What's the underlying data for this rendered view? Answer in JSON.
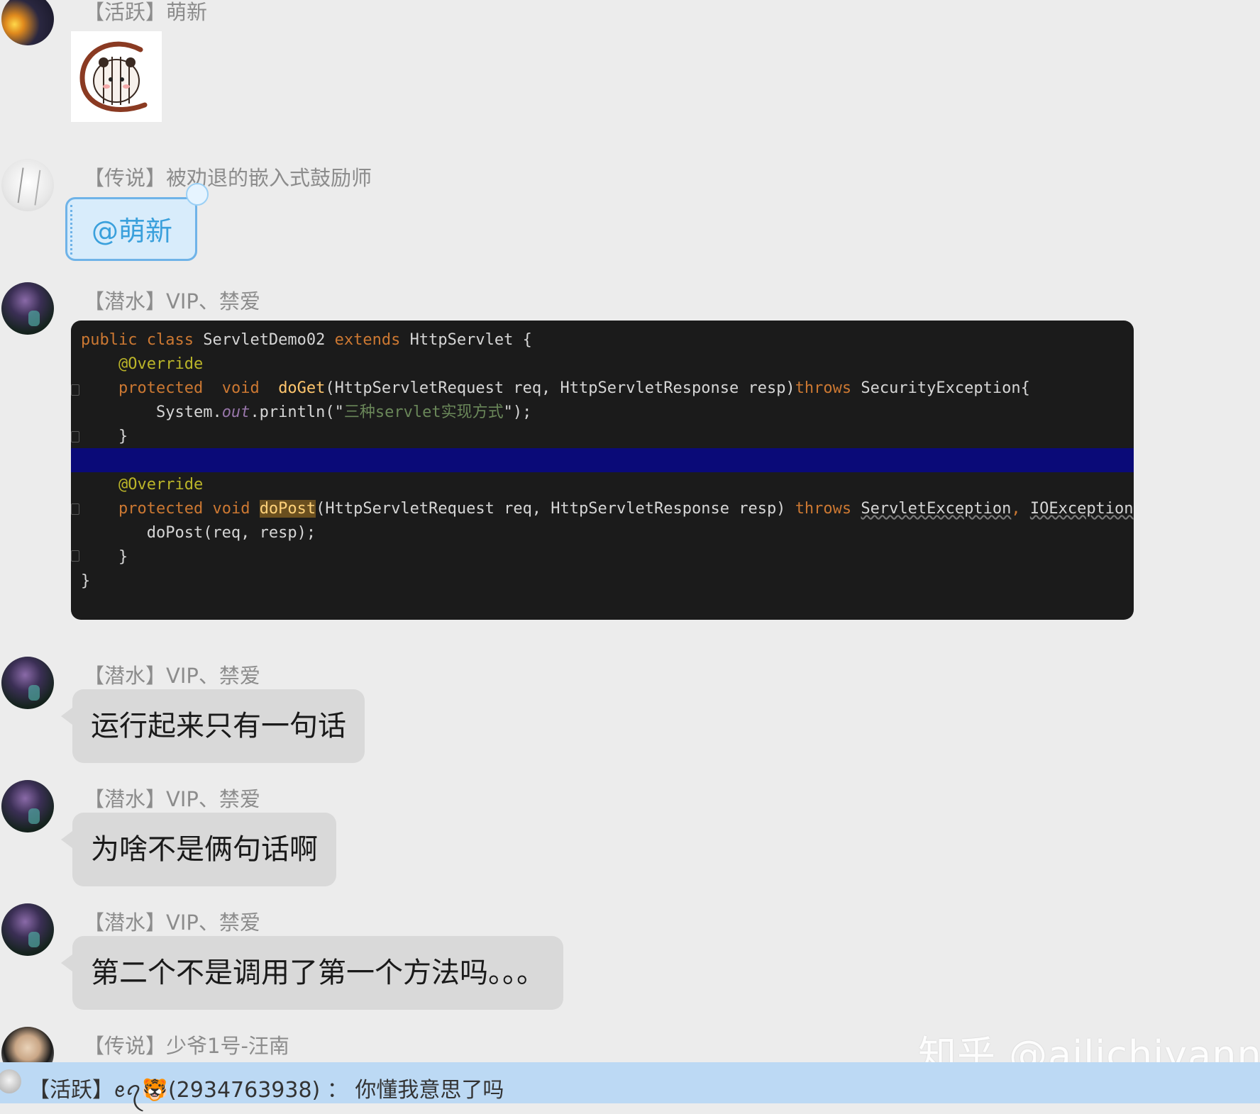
{
  "messages": [
    {
      "sender": "【活跃】萌新",
      "type": "sticker"
    },
    {
      "sender": "【传说】被劝退的嵌入式鼓励师",
      "type": "mention",
      "text": "@萌新"
    },
    {
      "sender": "【潜水】VIP、禁爱",
      "type": "code-image"
    },
    {
      "sender": "【潜水】VIP、禁爱",
      "type": "text",
      "text": "运行起来只有一句话"
    },
    {
      "sender": "【潜水】VIP、禁爱",
      "type": "text",
      "text": "为啥不是俩句话啊"
    },
    {
      "sender": "【潜水】VIP、禁爱",
      "type": "text",
      "text": "第二个不是调用了第一个方法吗。。。"
    },
    {
      "sender": "【传说】少爷1号-汪南",
      "type": "partial"
    }
  ],
  "code": {
    "l1_kw1": "public",
    "l1_kw2": "class",
    "l1_name": "ServletDemo02",
    "l1_kw3": "extends",
    "l1_rest": "HttpServlet {",
    "l2_ann": "@Override",
    "l3_kw1": "protected",
    "l3_kw2": "void",
    "l3_fn": "doGet",
    "l3_args": "(HttpServletRequest req, HttpServletResponse resp)",
    "l3_throws": "throws",
    "l3_ex": "SecurityException{",
    "l4_a": "System.",
    "l4_out": "out",
    "l4_b": ".println(\"",
    "l4_str": "三种servlet实现方式",
    "l4_c": "\");",
    "l5": "}",
    "l6_ann": "@Override",
    "l7_kw1": "protected",
    "l7_kw2": "void",
    "l7_fn": "doPost",
    "l7_args": "(HttpServletRequest req, HttpServletResponse resp)",
    "l7_throws": "throws",
    "l7_ex1": "ServletException",
    "l7_sep": ",",
    "l7_ex2": "IOException",
    "l7_end": "{",
    "l8": "doPost(req, resp);",
    "l9": "}",
    "l10": "}"
  },
  "watermark": "知乎 @ailichiyann",
  "notification": "【活跃】ꫀꪖ🐯(2934763938) ： 你懂我意思了吗"
}
